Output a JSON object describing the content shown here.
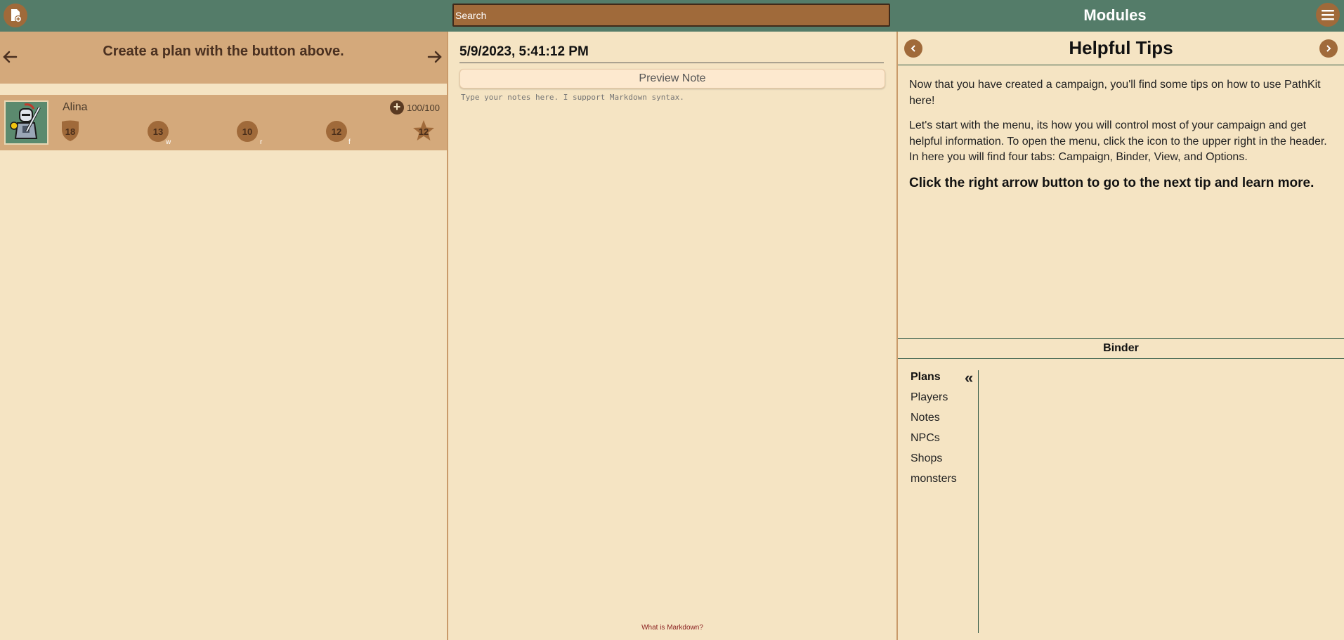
{
  "header": {
    "new_button_icon": "new-document-icon",
    "search_placeholder": "Search",
    "modules_title": "Modules",
    "menu_icon": "hamburger-menu-icon"
  },
  "plan": {
    "message": "Create a plan with the button above."
  },
  "players": [
    {
      "name": "Alina",
      "hp": "100/100",
      "stats": [
        {
          "value": "18",
          "shape": "shield",
          "sub": ""
        },
        {
          "value": "13",
          "shape": "circle",
          "sub": "w"
        },
        {
          "value": "10",
          "shape": "circle",
          "sub": "r"
        },
        {
          "value": "12",
          "shape": "circle",
          "sub": "f"
        },
        {
          "value": "12",
          "shape": "star",
          "sub": ""
        }
      ]
    }
  ],
  "note": {
    "date": "5/9/2023, 5:41:12 PM",
    "preview_label": "Preview Note",
    "placeholder": "Type your notes here. I support Markdown syntax.",
    "markdown_link": "What is Markdown?"
  },
  "tips": {
    "title": "Helpful Tips",
    "paragraphs": [
      "Now that you have created a campaign, you'll find some tips on how to use PathKit here!",
      "Let's start with the menu, its how you will control most of your campaign and get helpful information. To open the menu, click the icon to the upper right in the header. In here you will find four tabs: Campaign, Binder, View, and Options."
    ],
    "emphasis": "Click the right arrow button to go to the next tip and learn more."
  },
  "binder": {
    "title": "Binder",
    "items": [
      "Plans",
      "Players",
      "Notes",
      "NPCs",
      "Shops",
      "monsters"
    ],
    "collapse_glyph": "«"
  },
  "colors": {
    "header": "#547c69",
    "background": "#f5e4c3",
    "panel": "#d4a97b",
    "accent": "#a06a3a"
  }
}
